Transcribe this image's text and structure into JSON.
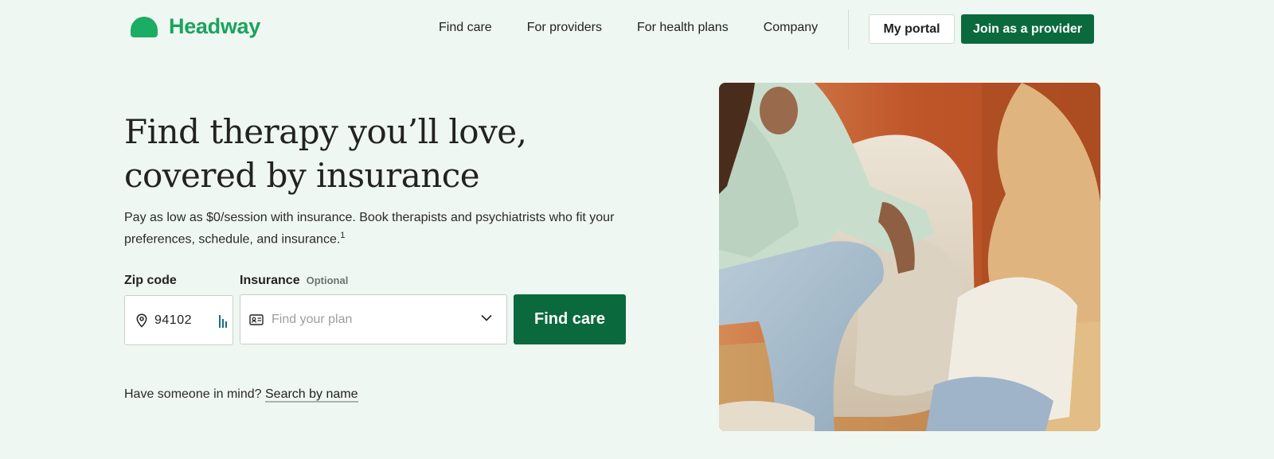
{
  "brand": {
    "name": "Headway",
    "color": "#1aa35f"
  },
  "nav": {
    "items": [
      "Find care",
      "For providers",
      "For health plans",
      "Company"
    ],
    "portal_label": "My portal",
    "join_label": "Join as a provider"
  },
  "hero": {
    "title_line1": "Find therapy you’ll love,",
    "title_line2": "covered by insurance",
    "subtitle_line1": "Pay as low as $0/session with insurance. Book therapists and psychiatrists who fit your",
    "subtitle_line2": "preferences, schedule, and insurance.",
    "footnote": "1"
  },
  "search": {
    "zip_label": "Zip code",
    "zip_value": "94102",
    "insurance_label": "Insurance",
    "insurance_optional": "Optional",
    "insurance_placeholder": "Find your plan",
    "submit_label": "Find care"
  },
  "alt_search": {
    "prompt": "Have someone in mind?",
    "link": "Search by name"
  },
  "colors": {
    "background": "#eff7f2",
    "primary_button": "#0b6a3d"
  }
}
